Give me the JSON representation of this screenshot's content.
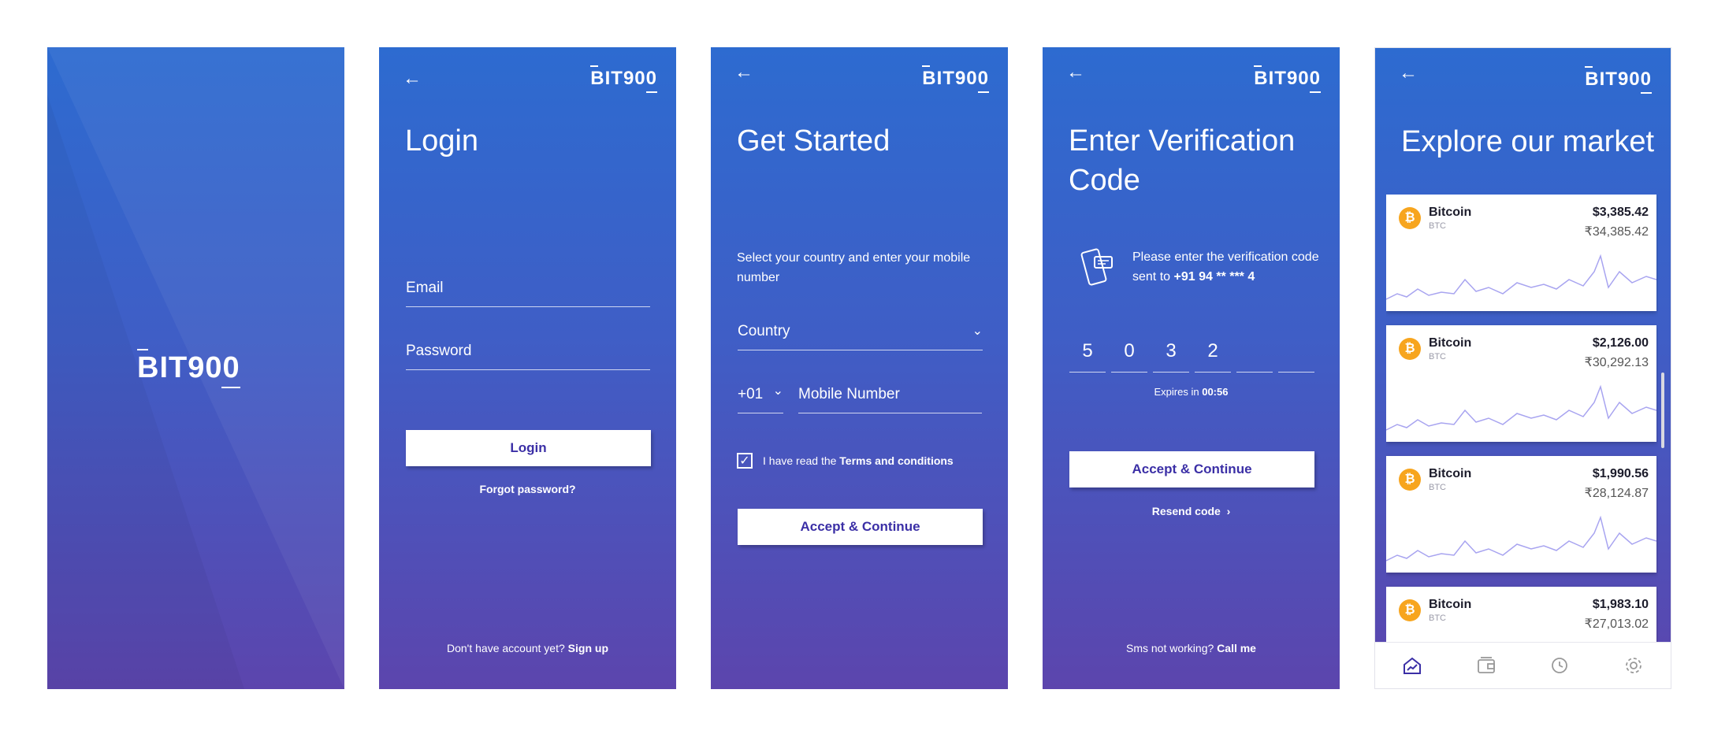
{
  "brand": {
    "logo": "BIT900"
  },
  "login": {
    "title": "Login",
    "email_placeholder": "Email",
    "password_placeholder": "Password",
    "login_button": "Login",
    "forgot_password": "Forgot password?",
    "footer_text": "Don't have account yet?",
    "footer_link": "Sign up"
  },
  "get_started": {
    "title": "Get Started",
    "instruction": "Select your country and enter your mobile number",
    "country_placeholder": "Country",
    "country_code": "+01",
    "mobile_placeholder": "Mobile Number",
    "terms_prefix": "I have read the",
    "terms_link": "Terms and conditions",
    "terms_checked": true,
    "continue_button": "Accept & Continue"
  },
  "verification": {
    "title_line1": "Enter Verification",
    "title_line2": "Code",
    "note": "Please enter the verification code sent to",
    "phone_masked": "+91 94 ** *** 4",
    "digits": [
      "5",
      "0",
      "3",
      "2",
      "",
      ""
    ],
    "expires_label": "Expires in",
    "expires_time": "00:56",
    "continue_button": "Accept & Continue",
    "resend": "Resend code",
    "footer_text": "Sms not working?",
    "footer_link": "Call me"
  },
  "market": {
    "title": "Explore our market",
    "coins": [
      {
        "name": "Bitcoin",
        "symbol": "BTC",
        "usd": "$3,385.42",
        "inr": "₹34,385.42"
      },
      {
        "name": "Bitcoin",
        "symbol": "BTC",
        "usd": "$2,126.00",
        "inr": "₹30,292.13"
      },
      {
        "name": "Bitcoin",
        "symbol": "BTC",
        "usd": "$1,990.56",
        "inr": "₹28,124.87"
      },
      {
        "name": "Bitcoin",
        "symbol": "BTC",
        "usd": "$1,983.10",
        "inr": "₹27,013.02"
      }
    ],
    "tabs": [
      "home-chart-icon",
      "wallet-icon",
      "history-icon",
      "settings-icon"
    ]
  },
  "colors": {
    "accent": "#3b2fa6",
    "coin": "#f7a51e",
    "spark": "#a8a4f0"
  }
}
